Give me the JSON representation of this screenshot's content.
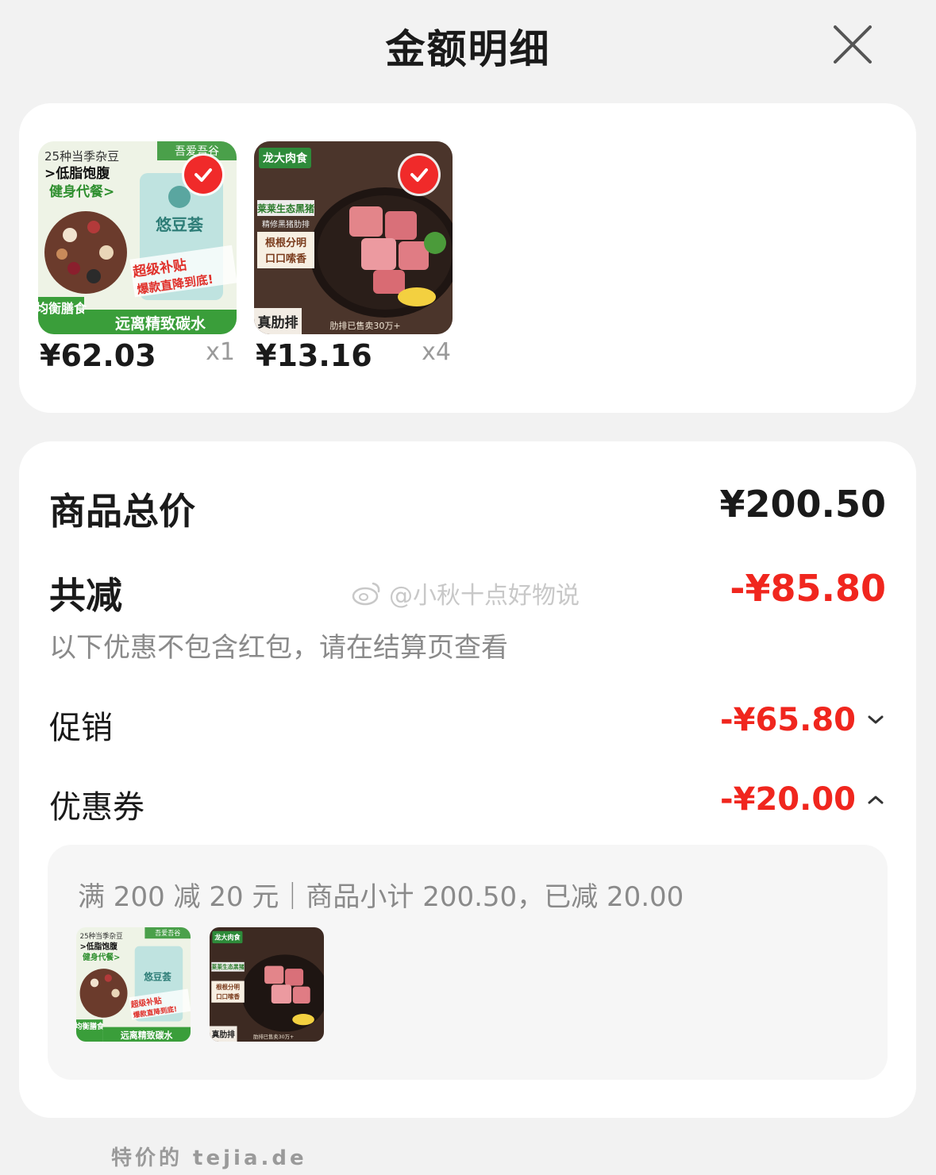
{
  "header": {
    "title": "金额明细",
    "close_icon": "close-icon"
  },
  "products": [
    {
      "price": "¥62.03",
      "qty": "x1",
      "selected": true,
      "image": {
        "bg": "#e8efe0",
        "brand": "吾爱吾谷",
        "line1": "25种当季杂豆",
        "line2": ">低脂饱腹",
        "line3": "健身代餐>",
        "pack_name": "悠豆荟",
        "promo1": "超级补贴",
        "promo2": "爆款直降到底!",
        "badge": "均衡膳食",
        "bottom": "远离精致碳水"
      }
    },
    {
      "price": "¥13.16",
      "qty": "x4",
      "selected": true,
      "image": {
        "bg": "#4a3328",
        "brand": "龙大肉食",
        "line1": "莱莱生态黑猪",
        "line2": "精修黑猪肋排",
        "line3": "根根分明",
        "line4": "口口嗦香",
        "badge": "真肋排",
        "bottom": "肋排已售卖30万+"
      }
    }
  ],
  "summary": {
    "total_label": "商品总价",
    "total_value": "¥200.50",
    "discount_label": "共减",
    "discount_value": "-¥85.80",
    "note": "以下优惠不包含红包，请在结算页查看",
    "promo_label": "促销",
    "promo_value": "-¥65.80",
    "promo_icon": "chevron-down-icon",
    "coupon_label": "优惠券",
    "coupon_value": "-¥20.00",
    "coupon_icon": "chevron-up-icon",
    "coupon_detail": "满 200 减 20 元｜商品小计 200.50，已减 20.00"
  },
  "watermark": "@小秋十点好物说",
  "site": "特价的 tejia.de",
  "colors": {
    "accent_red": "#f0261e",
    "check_red": "#f02a2a",
    "green": "#3aa13a"
  }
}
